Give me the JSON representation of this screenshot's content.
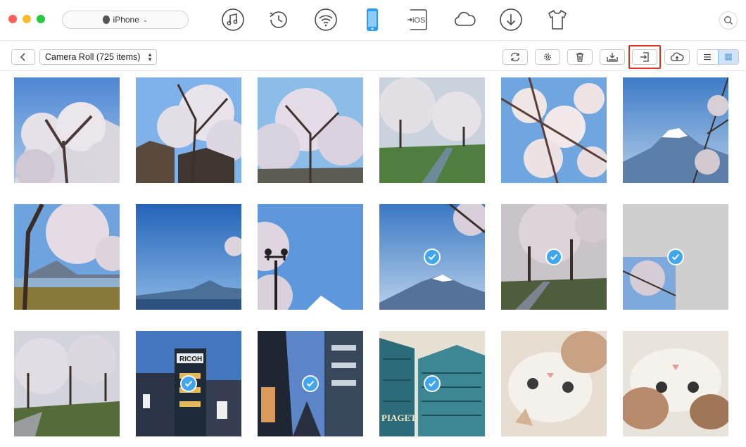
{
  "device": {
    "name": "iPhone",
    "icon": "apple-icon"
  },
  "nav_icons": [
    "music-icon",
    "history-icon",
    "wifi-icon",
    "phone-icon",
    "ios-transfer-icon",
    "cloud-icon",
    "download-icon",
    "tshirt-icon"
  ],
  "nav_ios_label": "iOS",
  "album": {
    "label": "Camera Roll (725 items)"
  },
  "toolbar_icons": [
    "refresh-icon",
    "settings-icon",
    "delete-icon",
    "export-to-computer-icon",
    "import-to-device-icon",
    "upload-cloud-icon"
  ],
  "highlighted_button": "import-to-device-icon",
  "colors": {
    "accent": "#3fa6ef",
    "highlight": "#e0311f",
    "active_view": "#cfe4f8"
  },
  "photos": [
    {
      "subject": "cherry blossom branches",
      "selected": false
    },
    {
      "subject": "cherry tree over roof",
      "selected": false
    },
    {
      "subject": "cherry blossom tree",
      "selected": false
    },
    {
      "subject": "cherry tree path with stream",
      "selected": false
    },
    {
      "subject": "cherry blossom close-up",
      "selected": false
    },
    {
      "subject": "Mount Fuji",
      "selected": false
    },
    {
      "subject": "tree by lake with Mount Fuji",
      "selected": false
    },
    {
      "subject": "blue sky over lake",
      "selected": false
    },
    {
      "subject": "street lamp under blossoms",
      "selected": false
    },
    {
      "subject": "Mount Fuji with blossoms",
      "selected": true
    },
    {
      "subject": "cherry tree river path",
      "selected": true
    },
    {
      "subject": "partially loaded image",
      "selected": true
    },
    {
      "subject": "cherry tree field",
      "selected": false
    },
    {
      "subject": "RICOH building",
      "selected": true
    },
    {
      "subject": "city street buildings",
      "selected": true
    },
    {
      "subject": "PIAGET building",
      "selected": true
    },
    {
      "subject": "kitten upside down",
      "selected": false
    },
    {
      "subject": "kitten lying",
      "selected": false
    }
  ],
  "photo_text": {
    "ricoh": "RICOH",
    "piaget": "PIAGET"
  }
}
